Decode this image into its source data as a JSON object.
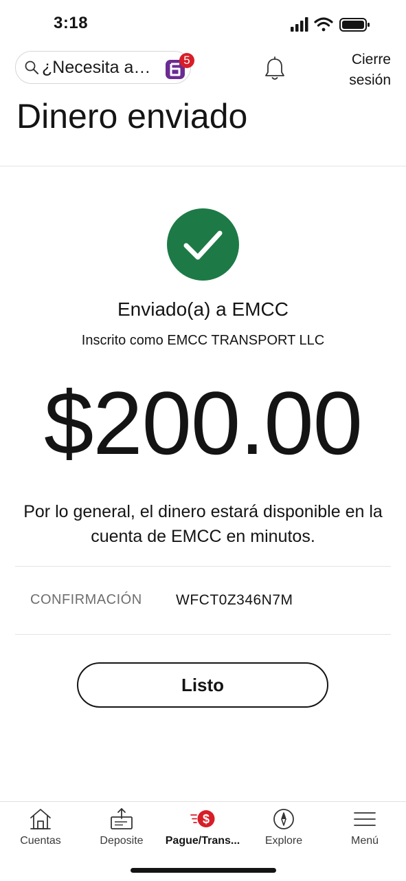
{
  "status_bar": {
    "time": "3:18"
  },
  "header": {
    "search_placeholder": "¿Necesita a…",
    "assistant_badge_count": "5",
    "signout_line1": "Cierre",
    "signout_line2": "sesión",
    "icons": [
      "search-icon",
      "assistant-icon",
      "bell-icon"
    ]
  },
  "page": {
    "title": "Dinero enviado"
  },
  "confirmation": {
    "sent_to": "Enviado(a) a EMCC",
    "enrolled_as": "Inscrito como EMCC TRANSPORT LLC",
    "amount": "$200.00",
    "availability": "Por lo general, el dinero estará disponible en la cuenta de EMCC en minutos.",
    "conf_label": "CONFIRMACIÓN",
    "conf_value": "WFCT0Z346N7M",
    "done_label": "Listo"
  },
  "bottom_nav": {
    "items": [
      {
        "label": "Cuentas",
        "icon": "home-icon"
      },
      {
        "label": "Deposite",
        "icon": "deposit-icon"
      },
      {
        "label": "Pague/Trans...",
        "icon": "pay-transfer-icon",
        "active": true
      },
      {
        "label": "Explore",
        "icon": "compass-icon"
      },
      {
        "label": "Menú",
        "icon": "menu-icon"
      }
    ]
  },
  "colors": {
    "success_green": "#1d7a46",
    "brand_red": "#d71e28",
    "assistant_purple": "#6b2c91",
    "text": "#141414",
    "muted_text": "#6e6e6e"
  }
}
